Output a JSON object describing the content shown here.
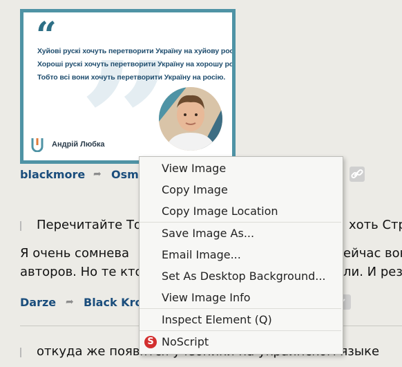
{
  "quote_card": {
    "lines": [
      "Хуйові рускі хочуть перетворити Україну на хуйову росію.",
      "Хороші рускі хочуть перетворити Україну на хорошу росію.",
      "Тобто всі вони хочуть перетворити Україну на росію."
    ],
    "author": "Андрій Любка",
    "open_quote": "“",
    "bg_quote": "”"
  },
  "post1": {
    "user": "blackmore",
    "reposted_by": "Osm"
  },
  "post2": {
    "text_line1_left": "Перечитайте То",
    "text_line1_right": "хоть Стру",
    "text_line2_left": "Я очень сомнева",
    "text_line2_right": "ейчас вон",
    "text_line3_left": "авторов. Но те кто",
    "text_line3_right": "ли. И резу",
    "user": "Darze",
    "reposted_by": "Black Kro"
  },
  "post3": {
    "text": "откуда же появятся учебники на украинском языке"
  },
  "context_menu": {
    "items": [
      {
        "label": "View Image"
      },
      {
        "label": "Copy Image"
      },
      {
        "label": "Copy Image Location"
      },
      {
        "label": "Save Image As..."
      },
      {
        "label": "Email Image..."
      },
      {
        "label": "Set As Desktop Background..."
      },
      {
        "label": "View Image Info"
      },
      {
        "label": "Inspect Element (Q)"
      },
      {
        "label": "NoScript"
      }
    ]
  },
  "colors": {
    "card_border": "#4f93a5",
    "quote_text": "#1f4d6e",
    "link": "#1a4d7c",
    "noscript": "#d32f2f"
  }
}
